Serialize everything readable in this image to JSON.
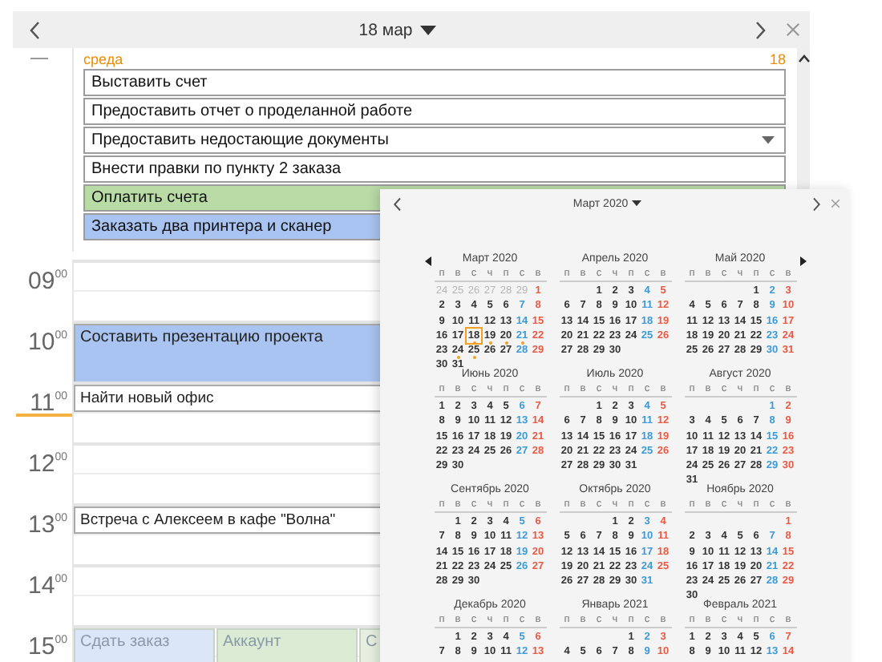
{
  "header": {
    "title": "18 мар"
  },
  "all_day": {
    "weekday": "среда",
    "day": "18",
    "tasks": [
      {
        "text": "Выставить счет",
        "color": "#ffffff",
        "dropdown": false
      },
      {
        "text": "Предоставить отчет о проделанной работе",
        "color": "#ffffff",
        "dropdown": false
      },
      {
        "text": "Предоставить недостающие документы",
        "color": "#ffffff",
        "dropdown": true
      },
      {
        "text": "Внести правки по пункту 2 заказа",
        "color": "#ffffff",
        "dropdown": false
      },
      {
        "text": "Оплатить счета",
        "color": "#b9dba6",
        "dropdown": false
      },
      {
        "text": "Заказать два принтера и сканер",
        "color": "#a9c4f0",
        "dropdown": false
      }
    ]
  },
  "hours": [
    {
      "hour": "09",
      "minutes": "00",
      "current": false
    },
    {
      "hour": "10",
      "minutes": "00",
      "current": false,
      "events": [
        {
          "text": "Составить презентацию проекта",
          "color": "#a9c4f0",
          "kind": "block"
        }
      ]
    },
    {
      "hour": "11",
      "minutes": "00",
      "current": true,
      "events": [
        {
          "text": "Найти новый офис",
          "color": "#ffffff",
          "kind": "line"
        }
      ]
    },
    {
      "hour": "12",
      "minutes": "00",
      "current": false
    },
    {
      "hour": "13",
      "minutes": "00",
      "current": false,
      "events": [
        {
          "text": "Встреча с Алексеем в кафе \"Волна\"",
          "color": "#ffffff",
          "kind": "line"
        }
      ]
    },
    {
      "hour": "14",
      "minutes": "00",
      "current": false
    },
    {
      "hour": "15",
      "minutes": "00",
      "current": false,
      "events": [
        {
          "text": "Сдать заказ",
          "color": "#dbe6f8",
          "kind": "block"
        },
        {
          "text": "Аккаунт",
          "color": "#dcebd3",
          "kind": "block"
        },
        {
          "text": "С",
          "color": "#e6efe0",
          "kind": "block"
        }
      ]
    }
  ],
  "popup": {
    "title": "Март 2020",
    "months": [
      {
        "title": "Март 2020",
        "weekdays": [
          "п",
          "в",
          "с",
          "ч",
          "п",
          "с",
          "в"
        ],
        "previous_month_days": [
          "24",
          "25",
          "26",
          "27",
          "28",
          "29"
        ],
        "weeks": [
          [
            {
              "day": "1",
              "selected": false,
              "event": false
            }
          ],
          [
            {
              "day": "2",
              "selected": false,
              "event": false
            },
            {
              "day": "3",
              "selected": false,
              "event": false
            },
            {
              "day": "4",
              "selected": false,
              "event": false
            },
            {
              "day": "5",
              "selected": false,
              "event": false
            },
            {
              "day": "6",
              "selected": false,
              "event": false
            },
            {
              "day": "7",
              "selected": false,
              "event": false
            },
            {
              "day": "8",
              "selected": false,
              "event": false
            }
          ],
          [
            {
              "day": "9",
              "selected": false,
              "event": false
            },
            {
              "day": "10",
              "selected": false,
              "event": false
            },
            {
              "day": "11",
              "selected": false,
              "event": false
            },
            {
              "day": "12",
              "selected": false,
              "event": false
            },
            {
              "day": "13",
              "selected": false,
              "event": false
            },
            {
              "day": "14",
              "selected": false,
              "event": false
            },
            {
              "day": "15",
              "selected": false,
              "event": false
            }
          ],
          [
            {
              "day": "16",
              "selected": false,
              "event": false
            },
            {
              "day": "17",
              "selected": false,
              "event": false
            },
            {
              "day": "18",
              "selected": true,
              "event": true
            },
            {
              "day": "19",
              "selected": false,
              "event": true
            },
            {
              "day": "20",
              "selected": false,
              "event": true
            },
            {
              "day": "21",
              "selected": false,
              "event": true
            },
            {
              "day": "22",
              "selected": false,
              "event": false
            }
          ],
          [
            {
              "day": "23",
              "selected": false,
              "event": false
            },
            {
              "day": "24",
              "selected": false,
              "event": true
            },
            {
              "day": "25",
              "selected": false,
              "event": true
            },
            {
              "day": "26",
              "selected": false,
              "event": false
            },
            {
              "day": "27",
              "selected": false,
              "event": false
            },
            {
              "day": "28",
              "selected": false,
              "event": false
            },
            {
              "day": "29",
              "selected": false,
              "event": false
            }
          ],
          [
            {
              "day": "30",
              "selected": false,
              "event": false
            },
            {
              "day": "31",
              "selected": false,
              "event": false
            }
          ]
        ]
      },
      {
        "title": "Апрель 2020",
        "weekdays": [
          "п",
          "в",
          "с",
          "ч",
          "п",
          "с",
          "в"
        ],
        "weeks": [
          [
            "1",
            "2",
            "3",
            "4",
            "5"
          ],
          [
            "6",
            "7",
            "8",
            "9",
            "10",
            "11",
            "12"
          ],
          [
            "13",
            "14",
            "15",
            "16",
            "17",
            "18",
            "19"
          ],
          [
            "20",
            "21",
            "22",
            "23",
            "24",
            "25",
            "26"
          ],
          [
            "27",
            "28",
            "29",
            "30"
          ]
        ]
      },
      {
        "title": "Май 2020",
        "weekdays": [
          "п",
          "в",
          "с",
          "ч",
          "п",
          "с",
          "в"
        ],
        "weeks": [
          [
            "1",
            "2",
            "3"
          ],
          [
            "4",
            "5",
            "6",
            "7",
            "8",
            "9",
            "10"
          ],
          [
            "11",
            "12",
            "13",
            "14",
            "15",
            "16",
            "17"
          ],
          [
            "18",
            "19",
            "20",
            "21",
            "22",
            "23",
            "24"
          ],
          [
            "25",
            "26",
            "27",
            "28",
            "29",
            "30",
            "31"
          ]
        ]
      },
      {
        "title": "Июнь 2020",
        "weekdays": [
          "п",
          "в",
          "с",
          "ч",
          "п",
          "с",
          "в"
        ],
        "weeks": [
          [
            "1",
            "2",
            "3",
            "4",
            "5",
            "6",
            "7"
          ],
          [
            "8",
            "9",
            "10",
            "11",
            "12",
            "13",
            "14"
          ],
          [
            "15",
            "16",
            "17",
            "18",
            "19",
            "20",
            "21"
          ],
          [
            "22",
            "23",
            "24",
            "25",
            "26",
            "27",
            "28"
          ],
          [
            "29",
            "30"
          ]
        ]
      },
      {
        "title": "Июль 2020",
        "weekdays": [
          "п",
          "в",
          "с",
          "ч",
          "п",
          "с",
          "в"
        ],
        "weeks": [
          [
            "1",
            "2",
            "3",
            "4",
            "5"
          ],
          [
            "6",
            "7",
            "8",
            "9",
            "10",
            "11",
            "12"
          ],
          [
            "13",
            "14",
            "15",
            "16",
            "17",
            "18",
            "19"
          ],
          [
            "20",
            "21",
            "22",
            "23",
            "24",
            "25",
            "26"
          ],
          [
            "27",
            "28",
            "29",
            "30",
            "31"
          ]
        ]
      },
      {
        "title": "Август 2020",
        "weekdays": [
          "п",
          "в",
          "с",
          "ч",
          "п",
          "с",
          "в"
        ],
        "weeks": [
          [
            "1",
            "2"
          ],
          [
            "3",
            "4",
            "5",
            "6",
            "7",
            "8",
            "9"
          ],
          [
            "10",
            "11",
            "12",
            "13",
            "14",
            "15",
            "16"
          ],
          [
            "17",
            "18",
            "19",
            "20",
            "21",
            "22",
            "23"
          ],
          [
            "24",
            "25",
            "26",
            "27",
            "28",
            "29",
            "30"
          ],
          [
            "31"
          ]
        ]
      },
      {
        "title": "Сентябрь 2020",
        "weekdays": [
          "п",
          "в",
          "с",
          "ч",
          "п",
          "с",
          "в"
        ],
        "weeks": [
          [
            "1",
            "2",
            "3",
            "4",
            "5",
            "6"
          ],
          [
            "7",
            "8",
            "9",
            "10",
            "11",
            "12",
            "13"
          ],
          [
            "14",
            "15",
            "16",
            "17",
            "18",
            "19",
            "20"
          ],
          [
            "21",
            "22",
            "23",
            "24",
            "25",
            "26",
            "27"
          ],
          [
            "28",
            "29",
            "30"
          ]
        ]
      },
      {
        "title": "Октябрь 2020",
        "weekdays": [
          "п",
          "в",
          "с",
          "ч",
          "п",
          "с",
          "в"
        ],
        "weeks": [
          [
            "1",
            "2",
            "3",
            "4"
          ],
          [
            "5",
            "6",
            "7",
            "8",
            "9",
            "10",
            "11"
          ],
          [
            "12",
            "13",
            "14",
            "15",
            "16",
            "17",
            "18"
          ],
          [
            "19",
            "20",
            "21",
            "22",
            "23",
            "24",
            "25"
          ],
          [
            "26",
            "27",
            "28",
            "29",
            "30",
            "31"
          ]
        ]
      },
      {
        "title": "Ноябрь 2020",
        "weekdays": [
          "п",
          "в",
          "с",
          "ч",
          "п",
          "с",
          "в"
        ],
        "weeks": [
          [
            "1"
          ],
          [
            "2",
            "3",
            "4",
            "5",
            "6",
            "7",
            "8"
          ],
          [
            "9",
            "10",
            "11",
            "12",
            "13",
            "14",
            "15"
          ],
          [
            "16",
            "17",
            "18",
            "19",
            "20",
            "21",
            "22"
          ],
          [
            "23",
            "24",
            "25",
            "26",
            "27",
            "28",
            "29"
          ],
          [
            "30"
          ]
        ]
      },
      {
        "title": "Декабрь 2020",
        "weekdays": [
          "п",
          "в",
          "с",
          "ч",
          "п",
          "с",
          "в"
        ],
        "weeks": [
          [
            "1",
            "2",
            "3",
            "4",
            "5",
            "6"
          ],
          [
            "7",
            "8",
            "9",
            "10",
            "11",
            "12",
            "13"
          ]
        ]
      },
      {
        "title": "Январь 2021",
        "weekdays": [
          "п",
          "в",
          "с",
          "ч",
          "п",
          "с",
          "в"
        ],
        "weeks": [
          [
            "1",
            "2",
            "3"
          ],
          [
            "4",
            "5",
            "6",
            "7",
            "8",
            "9",
            "10"
          ]
        ]
      },
      {
        "title": "Февраль 2021",
        "weekdays": [
          "п",
          "в",
          "с",
          "ч",
          "п",
          "с",
          "в"
        ],
        "weeks": [
          [
            "1",
            "2",
            "3",
            "4",
            "5",
            "6",
            "7"
          ],
          [
            "8",
            "9",
            "10",
            "11",
            "12",
            "13",
            "14"
          ]
        ]
      }
    ]
  }
}
